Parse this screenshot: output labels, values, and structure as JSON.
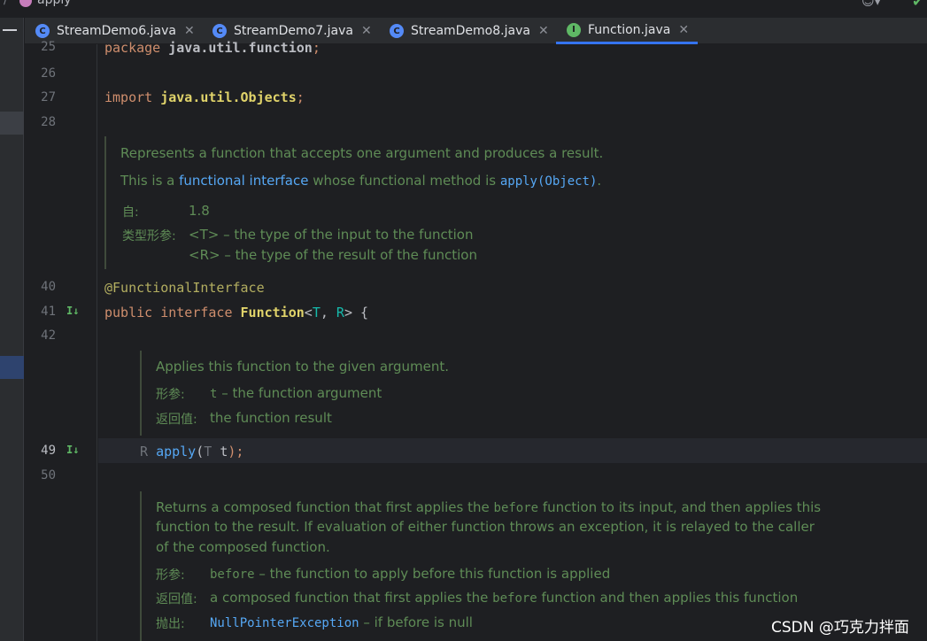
{
  "breadcrumb": {
    "sep": "/",
    "label": "apply"
  },
  "tabs": [
    {
      "label": "StreamDemo6.java",
      "icon": "C",
      "close": "✕"
    },
    {
      "label": "StreamDemo7.java",
      "icon": "C",
      "close": "✕"
    },
    {
      "label": "StreamDemo8.java",
      "icon": "C",
      "close": "✕"
    },
    {
      "label": "Function.java",
      "icon": "I",
      "close": "✕"
    }
  ],
  "line_numbers": [
    "25",
    "26",
    "27",
    "28",
    "40",
    "41",
    "42",
    "49",
    "50"
  ],
  "code": {
    "l25_kw": "package",
    "l25_pkg": "java.util.function",
    "l25_semi": ";",
    "l27_kw": "import",
    "l27_pkg": "java.util.Objects",
    "l27_semi": ";",
    "l40_ann": "@FunctionalInterface",
    "l41_kw1": "public",
    "l41_kw2": "interface",
    "l41_name": "Function",
    "l41_lt": "<",
    "l41_T": "T",
    "l41_comma": ", ",
    "l41_R": "R",
    "l41_rest": "> {",
    "l49_R": "R",
    "l49_fn": "apply",
    "l49_open": "(",
    "l49_T": "T",
    "l49_t": "t",
    "l49_close": ");"
  },
  "doc1": {
    "line1": "Represents a function that accepts one argument and produces a result.",
    "line2_a": "This is a ",
    "line2_link": "functional interface",
    "line2_b": " whose functional method is ",
    "line2_method": "apply(Object)",
    "line2_c": ".",
    "since_tag": "自:",
    "since_val": "1.8",
    "params_tag": "类型形参:",
    "param1": "<T> – the type of the input to the function",
    "param2": "<R> – the type of the result of the function"
  },
  "doc2": {
    "line1": "Applies this function to the given argument.",
    "params_tag": "形参:",
    "param_name": "t",
    "param_desc": " – the function argument",
    "return_tag": "返回值:",
    "return_desc": "the function result"
  },
  "doc3": {
    "line1_a": "Returns a composed function that first applies the ",
    "line1_mono": "before",
    "line1_b": " function to its input, and then applies this",
    "line2": "function to the result. If evaluation of either function throws an exception, it is relayed to the caller",
    "line3": "of the composed function.",
    "params_tag": "形参:",
    "param_name": "before",
    "param_desc": " – the function to apply before this function is applied",
    "return_tag": "返回值:",
    "return_a": "a composed function that first applies the ",
    "return_mono": "before",
    "return_b": " function and then applies this function",
    "throws_tag": "抛出:",
    "throws_name": "NullPointerException",
    "throws_desc": " – if before is null"
  },
  "watermark": "CSDN @巧克力拌面",
  "colors": {
    "background": "#1e1f22",
    "keyword": "#cf8e6d",
    "annotation": "#b3ae60",
    "doc_text": "#5f8c56",
    "link": "#56a8f5",
    "active_tab_underline": "#3574f0"
  }
}
